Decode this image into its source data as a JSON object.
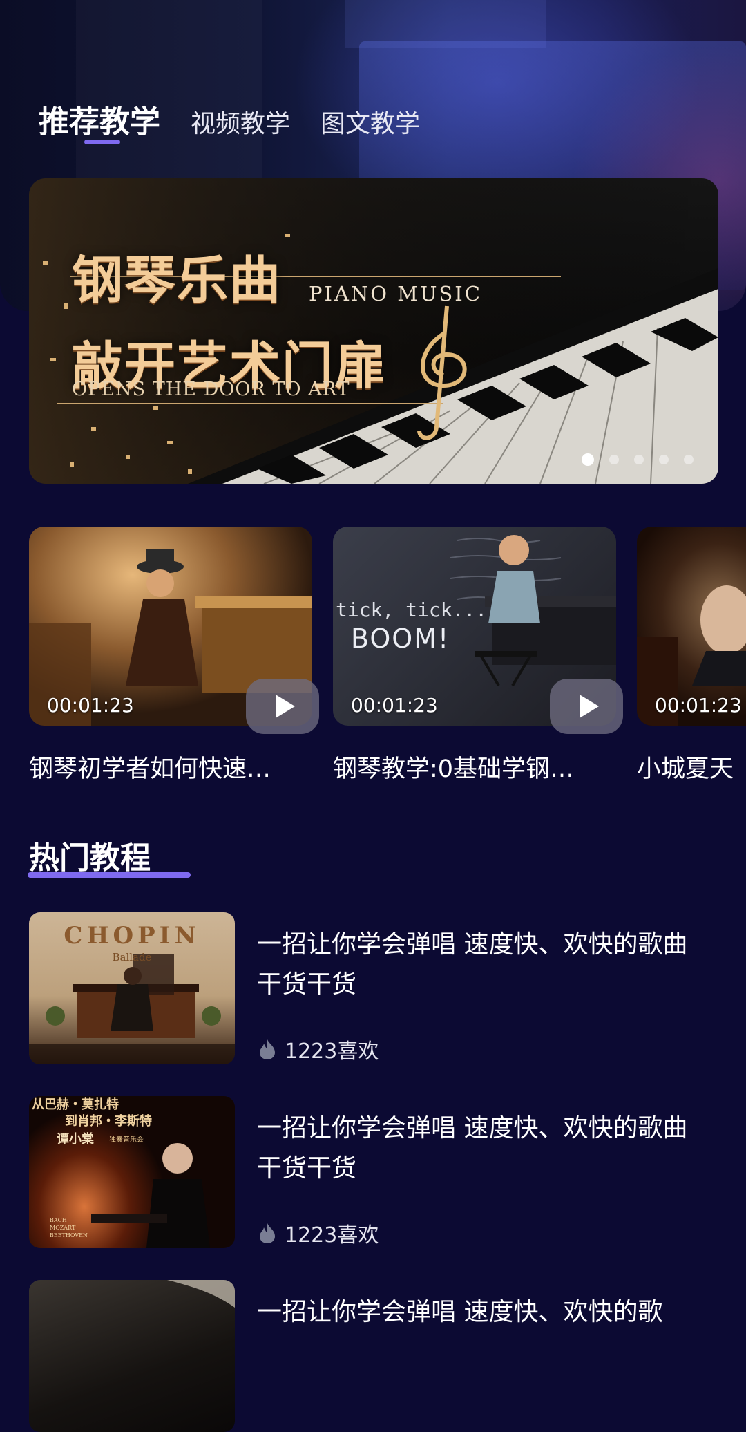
{
  "tabs": [
    {
      "label": "推荐教学",
      "active": true
    },
    {
      "label": "视频教学",
      "active": false
    },
    {
      "label": "图文教学",
      "active": false
    }
  ],
  "banner": {
    "title_line1": "钢琴乐曲",
    "title_line2": "敲开艺术门扉",
    "subtitle_en": "PIANO MUSIC",
    "tagline_en": "OPENS THE DOOR TO ART",
    "slide_count": 5,
    "active_slide": 1
  },
  "videos": [
    {
      "duration": "00:01:23",
      "title": "钢琴初学者如何快速…",
      "thumb_text_1": "",
      "thumb_text_2": ""
    },
    {
      "duration": "00:01:23",
      "title": "钢琴教学:0基础学钢…",
      "thumb_text_1": "tick, tick...",
      "thumb_text_2": "BOOM!"
    },
    {
      "duration": "00:01:23",
      "title": "小城夏天",
      "thumb_text_1": "",
      "thumb_text_2": ""
    }
  ],
  "section": {
    "title": "热门教程"
  },
  "tutorials": [
    {
      "title": "一招让你学会弹唱 速度快、欢快的歌曲 干货干货",
      "likes": "1223喜欢",
      "thumb_text_1": "CHOPIN",
      "thumb_text_2": "Ballade"
    },
    {
      "title": "一招让你学会弹唱 速度快、欢快的歌曲 干货干货",
      "likes": "1223喜欢",
      "thumb_text_1": "从巴赫・莫扎特",
      "thumb_text_2": "到肖邦・李斯特",
      "thumb_text_3": "谭小棠",
      "thumb_text_4": "独奏音乐会",
      "thumb_text_5": "BACH MOZART BEETHOVEN"
    },
    {
      "title": "一招让你学会弹唱 速度快、欢快的歌",
      "likes": "",
      "thumb_text_1": ""
    }
  ],
  "colors": {
    "background": "#0c0a33",
    "accent": "#7f6af0",
    "banner_gold": "#f3cc98"
  },
  "icons": {
    "play": "play-icon",
    "likes": "flame-icon"
  }
}
